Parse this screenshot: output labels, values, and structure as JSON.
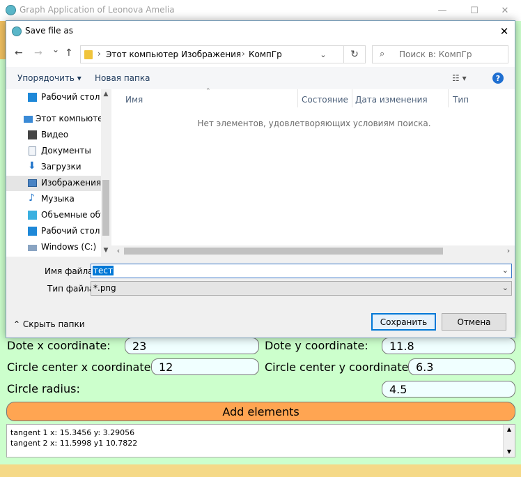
{
  "app": {
    "title": "Graph Application of Leonova Amelia",
    "minimize_glyph": "—",
    "maximize_glyph": "☐",
    "close_glyph": "✕",
    "accent_color": "#ccffcc",
    "button_color": "#ffa552"
  },
  "form": {
    "dot_x_label": "Dote x coordinate:",
    "dot_x_value": "23",
    "dot_y_label": "Dote y coordinate:",
    "dot_y_value": "11.8",
    "circle_cx_label": "Circle center x coordinate:",
    "circle_cx_value": "12",
    "circle_cy_label": "Circle center y coordinate:",
    "circle_cy_value": "6.3",
    "radius_label": "Circle radius:",
    "radius_value": "4.5",
    "add_button": "Add elements"
  },
  "output": {
    "lines": [
      "tangent 1   x: 15.3456 y: 3.29056",
      "tangent 2   x: 11.5998 y1 10.7822"
    ]
  },
  "dialog": {
    "title": "Save file as",
    "close_glyph": "✕",
    "nav": {
      "back": "←",
      "forward": "→",
      "recent": "⌄",
      "up": "↑",
      "breadcrumb": [
        "Этот компьютер",
        "Изображения",
        "КомпГр"
      ],
      "separator": "›",
      "refresh": "↻",
      "search_placeholder": "Поиск в: КомпГр"
    },
    "toolbar": {
      "organize": "Упорядочить ▾",
      "new_folder": "Новая папка",
      "view": "☷ ▾",
      "help": "?"
    },
    "tree": [
      {
        "label": "Рабочий стол",
        "icon": "desktop-icon",
        "color": "#1e88d8"
      },
      {
        "label": "Этот компьютер",
        "icon": "computer-icon",
        "color": "#3a8ad6"
      },
      {
        "label": "Видео",
        "icon": "video-icon",
        "color": "#444444"
      },
      {
        "label": "Документы",
        "icon": "documents-icon",
        "color": "#8a9bb0"
      },
      {
        "label": "Загрузки",
        "icon": "downloads-icon",
        "color": "#1f73c9"
      },
      {
        "label": "Изображения",
        "icon": "pictures-icon",
        "color": "#4a84c4"
      },
      {
        "label": "Музыка",
        "icon": "music-icon",
        "color": "#1f73c9"
      },
      {
        "label": "Объемные объ",
        "icon": "3d-objects-icon",
        "color": "#3ab0e0"
      },
      {
        "label": "Рабочий стол",
        "icon": "desktop-icon",
        "color": "#1e88d8"
      },
      {
        "label": "Windows (C:)",
        "icon": "drive-icon",
        "color": "#8aa4c2"
      }
    ],
    "columns": [
      "Имя",
      "Состояние",
      "Дата изменения",
      "Тип"
    ],
    "empty_message": "Нет элементов, удовлетворяющих условиям поиска.",
    "filename_label": "Имя файла:",
    "filename_value": "тест",
    "filetype_label": "Тип файла:",
    "filetype_value": "*.png",
    "hide_folders": "⌃ Скрыть папки",
    "save_button": "Сохранить",
    "cancel_button": "Отмена"
  }
}
